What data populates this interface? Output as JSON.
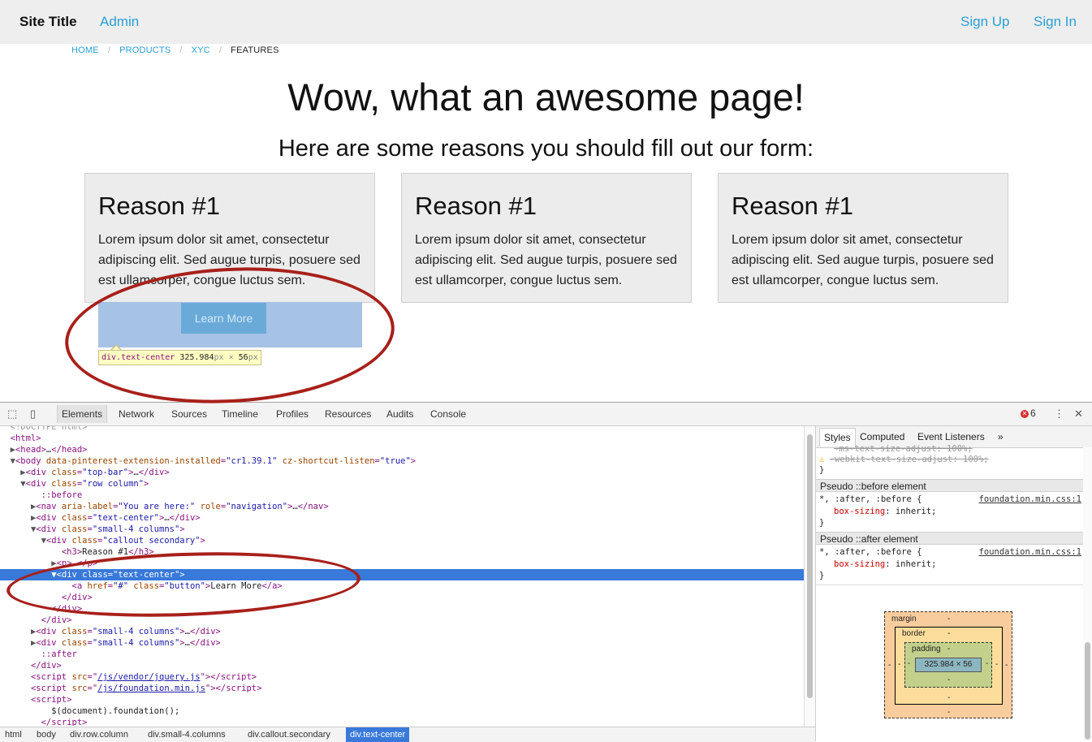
{
  "topbar": {
    "site_title": "Site Title",
    "admin": "Admin",
    "sign_up": "Sign Up",
    "sign_in": "Sign In"
  },
  "breadcrumb": [
    "HOME",
    "PRODUCTS",
    "XYC",
    "FEATURES"
  ],
  "breadcrumb_sep": "/",
  "headline": "Wow, what an awesome page!",
  "subhead": "Here are some reasons you should fill out our form:",
  "callouts": [
    {
      "title": "Reason #1",
      "body": "Lorem ipsum dolor sit amet, consectetur adipiscing elit. Sed augue turpis, posuere sed est ullamcorper, congue luctus sem."
    },
    {
      "title": "Reason #1",
      "body": "Lorem ipsum dolor sit amet, consectetur adipiscing elit. Sed augue turpis, posuere sed est ullamcorper, congue luctus sem."
    },
    {
      "title": "Reason #1",
      "body": "Lorem ipsum dolor sit amet, consectetur adipiscing elit. Sed augue turpis, posuere sed est ullamcorper, congue luctus sem."
    }
  ],
  "learn_more": "Learn More",
  "tooltip": {
    "name": "div.text-center",
    "w": "325.984",
    "px": "px",
    "x": "×",
    "h": "56"
  },
  "devtools": {
    "tabs": [
      "Elements",
      "Network",
      "Sources",
      "Timeline",
      "Profiles",
      "Resources",
      "Audits",
      "Console"
    ],
    "error_count": "6",
    "sidebar_tabs": [
      "Styles",
      "Computed",
      "Event Listeners",
      "»"
    ],
    "breadcrumbs": [
      "html",
      "body",
      "div.row.column",
      "div.small-4.columns",
      "div.callout.secondary",
      "div.text-center"
    ],
    "styles": {
      "struck_1": "-ms-text-size-adjust: 100%;",
      "struck_2": "-webkit-text-size-adjust: 100%;",
      "close_brace": "}",
      "pseudo_before": "Pseudo ::before element",
      "pseudo_after": "Pseudo ::after element",
      "selector": "*, :after, :before {",
      "source": "foundation.min.css:1",
      "prop": "box-sizing",
      "value": ": inherit;"
    },
    "box_model": {
      "margin": "margin",
      "border": "border",
      "padding": "padding",
      "dash": "-",
      "content": "325.984 × 56"
    }
  },
  "colors": {
    "link": "#2a9fd6",
    "selection": "#3879d9",
    "annotation": "#a8201a"
  }
}
